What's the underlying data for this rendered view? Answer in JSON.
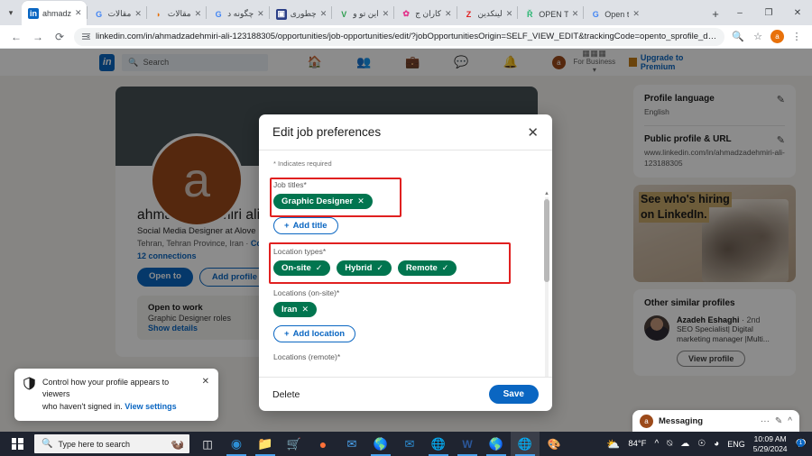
{
  "browser": {
    "tabs": [
      {
        "title": "ahmadz",
        "favicon": "linkedin-icon",
        "active": true
      },
      {
        "title": "مقالات",
        "favicon": "google-icon",
        "active": false
      },
      {
        "title": "مقالات",
        "favicon": "orange-doc-icon",
        "active": false
      },
      {
        "title": "چگونه د",
        "favicon": "google-icon",
        "active": false
      },
      {
        "title": "چطوری",
        "favicon": "blue-app-icon",
        "active": false
      },
      {
        "title": "این تو و",
        "favicon": "v-icon",
        "active": false
      },
      {
        "title": "کاران ج",
        "favicon": "pink-icon",
        "active": false
      },
      {
        "title": "لینکدین",
        "favicon": "z-icon",
        "active": false
      },
      {
        "title": "OPEN T",
        "favicon": "rj-icon",
        "active": false
      },
      {
        "title": "Open t",
        "favicon": "google-icon",
        "active": false
      }
    ],
    "new_tab_label": "+",
    "window_controls": {
      "minimize": "–",
      "maximize": "❐",
      "close": "✕"
    },
    "url": "linkedin.com/in/ahmadzadehmiri-ali-123188305/opportunities/job-opportunities/edit/?jobOpportunitiesOrigin=SELF_VIEW_EDIT&trackingCode=opento_sprofile_details...",
    "nav": {
      "back": "←",
      "forward": "→",
      "reload": "⟳"
    },
    "profile_initial": "a"
  },
  "linkedin_nav": {
    "logo": "in",
    "search_placeholder": "Search",
    "icons": [
      "home-icon",
      "network-icon",
      "jobs-icon",
      "messaging-icon",
      "notifications-icon"
    ],
    "me_initial": "a",
    "for_business": "For Business",
    "premium_label": "Upgrade to Premium"
  },
  "profile": {
    "avatar_initial": "a",
    "name": "ahmadzadehmiri ali",
    "headline": "Social Media Designer at Alove",
    "location": "Tehran, Tehran Province, Iran",
    "contact_info": "Contact info",
    "connections": "12 connections",
    "buttons": {
      "open_to": "Open to",
      "add_section": "Add profile section"
    },
    "open_to_work": {
      "title": "Open to work",
      "roles": "Graphic Designer roles",
      "link": "Show details"
    }
  },
  "right_rail": {
    "profile_language": {
      "title": "Profile language",
      "value": "English",
      "edit": "pencil-icon"
    },
    "public_url": {
      "title": "Public profile & URL",
      "value": "www.linkedin.com/in/ahmadzadehmiri-ali-123188305",
      "edit": "pencil-icon"
    },
    "ad": {
      "line1": "See who's hiring",
      "line2": "on LinkedIn."
    },
    "similar": {
      "title": "Other similar profiles",
      "person": {
        "name": "Azadeh Eshaghi",
        "degree": "· 2nd",
        "headline": "SEO Specialist| Digital marketing manager |Multi...",
        "button": "View profile"
      }
    }
  },
  "messaging": {
    "label": "Messaging",
    "avatar_initial": "a",
    "more": "···",
    "compose": "compose-icon",
    "expand": "chevron-up-icon"
  },
  "toast": {
    "icon": "shield-icon",
    "line1": "Control how your profile appears to viewers",
    "line2": "who haven't signed in.",
    "link": "View settings",
    "close": "✕"
  },
  "modal": {
    "title": "Edit job preferences",
    "close": "✕",
    "required_note": "* Indicates required",
    "sections": [
      {
        "label": "Job titles*",
        "chips": [
          {
            "text": "Graphic Designer",
            "remove": "✕"
          }
        ],
        "add_button": "Add title",
        "highlighted": true
      },
      {
        "label": "Location types*",
        "chips": [
          {
            "text": "On-site",
            "check": "✓"
          },
          {
            "text": "Hybrid",
            "check": "✓"
          },
          {
            "text": "Remote",
            "check": "✓"
          }
        ],
        "highlighted": true
      },
      {
        "label": "Locations (on-site)*",
        "chips": [
          {
            "text": "Iran",
            "remove": "✕"
          }
        ],
        "add_button": "Add location",
        "highlighted": false
      },
      {
        "label": "Locations (remote)*",
        "chips": [],
        "highlighted": false
      }
    ],
    "footer": {
      "delete": "Delete",
      "save": "Save"
    },
    "colors": {
      "chip_green": "#01754f",
      "save_blue": "#0a66c2",
      "highlight_red": "#e02020"
    }
  },
  "taskbar": {
    "search_placeholder": "Type here to search",
    "weather": "84°F",
    "language": "ENG",
    "time": "10:09 AM",
    "date": "5/29/2024",
    "apps": [
      "task-view-icon",
      "edge-icon",
      "file-explorer-icon",
      "store-icon",
      "firefox-icon",
      "mail-icon",
      "chrome-icon",
      "outlook-icon",
      "chrome-icon",
      "word-icon",
      "chrome-icon",
      "chrome-icon",
      "paint-icon"
    ],
    "tray": [
      "chevron-up-icon",
      "onedrive-icon",
      "cloud-icon",
      "usb-icon",
      "wifi-icon"
    ],
    "notification_icon": "notifications-icon"
  }
}
